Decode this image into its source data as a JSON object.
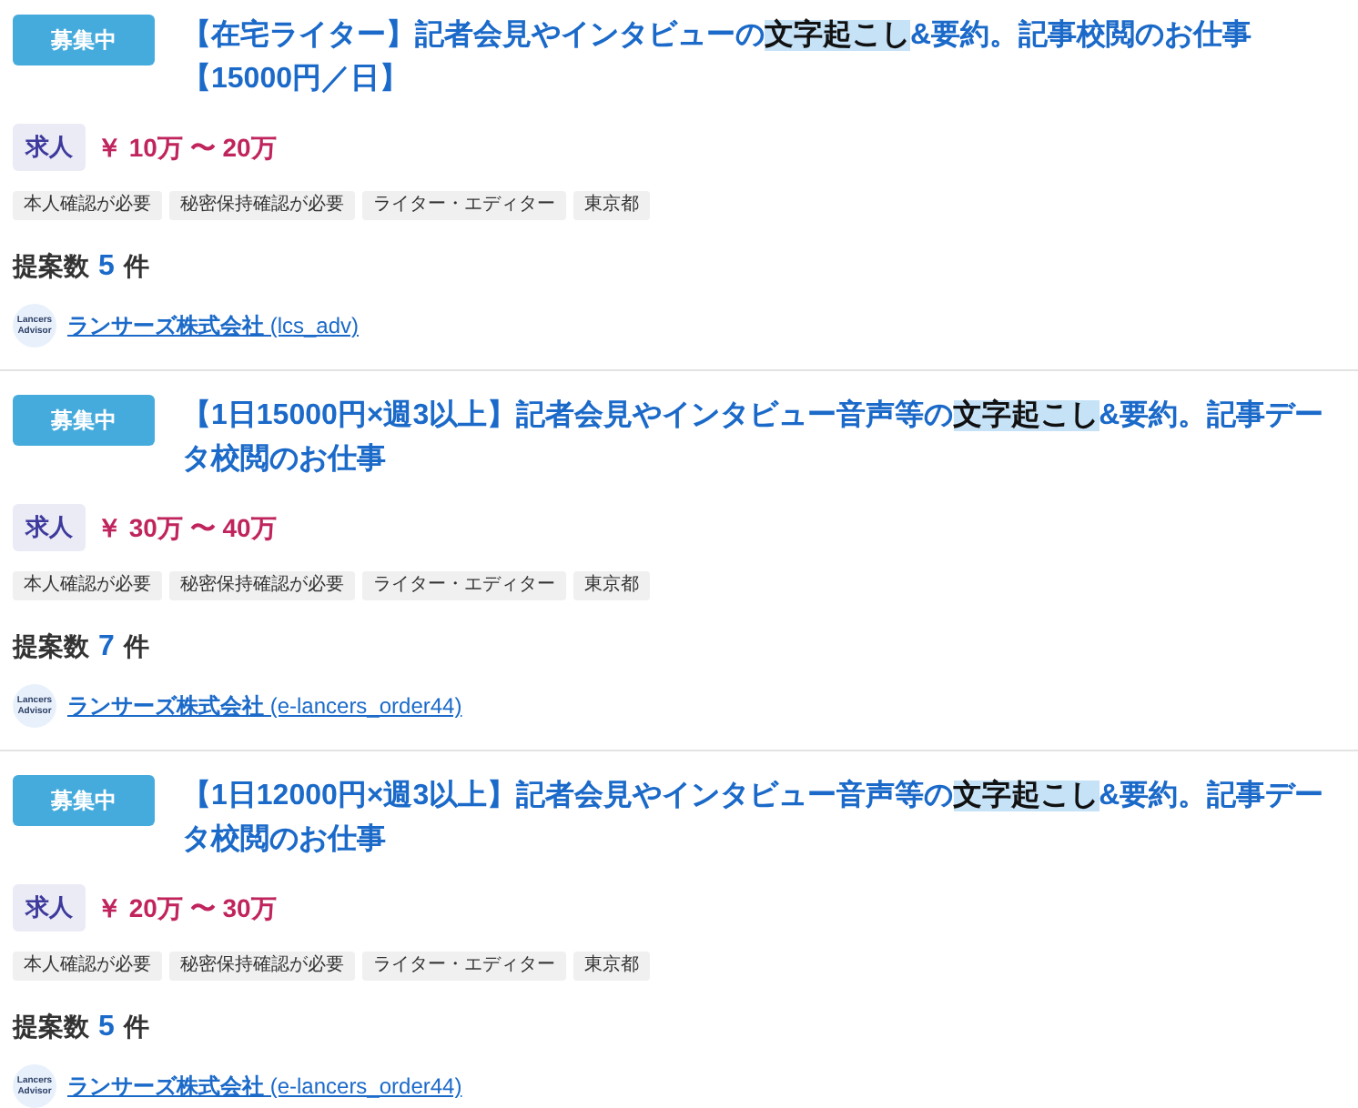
{
  "listings": [
    {
      "status": "募集中",
      "title": [
        {
          "text": "【在宅ライター】記者会見やインタビューの",
          "highlighted": false
        },
        {
          "text": "文字起こし",
          "highlighted": true
        },
        {
          "text": "&要約。記事校閲のお仕事【15000円／日】",
          "highlighted": false
        }
      ],
      "job_type": "求人",
      "salary": "￥ 10万 〜 20万",
      "tags": [
        "本人確認が必要",
        "秘密保持確認が必要",
        "ライター・エディター",
        "東京都"
      ],
      "proposals": {
        "label": "提案数",
        "count": "5",
        "unit": "件"
      },
      "client": {
        "logo_text": "Lancers Advisor",
        "name": "**ランサーズ株式会社** (lcs_adv)"
      }
    },
    {
      "status": "募集中",
      "title": [
        {
          "text": "【1日15000円×週3以上】記者会見やインタビュー音声等の",
          "highlighted": false
        },
        {
          "text": "文字起こし",
          "highlighted": true
        },
        {
          "text": "&要約。記事データ校閲のお仕事",
          "highlighted": false
        }
      ],
      "job_type": "求人",
      "salary": "￥ 30万 〜 40万",
      "tags": [
        "本人確認が必要",
        "秘密保持確認が必要",
        "ライター・エディター",
        "東京都"
      ],
      "proposals": {
        "label": "提案数",
        "count": "7",
        "unit": "件"
      },
      "client": {
        "logo_text": "Lancers Advisor",
        "name": "**ランサーズ株式会社** (e-lancers_order44)"
      }
    },
    {
      "status": "募集中",
      "title": [
        {
          "text": "【1日12000円×週3以上】記者会見やインタビュー音声等の",
          "highlighted": false
        },
        {
          "text": "文字起こし",
          "highlighted": true
        },
        {
          "text": "&要約。記事データ校閲のお仕事",
          "highlighted": false
        }
      ],
      "job_type": "求人",
      "salary": "￥ 20万 〜 30万",
      "tags": [
        "本人確認が必要",
        "秘密保持確認が必要",
        "ライター・エディター",
        "東京都"
      ],
      "proposals": {
        "label": "提案数",
        "count": "5",
        "unit": "件"
      },
      "client": {
        "logo_text": "Lancers Advisor",
        "name": "**ランサーズ株式会社** (e-lancers_order44)"
      }
    }
  ]
}
